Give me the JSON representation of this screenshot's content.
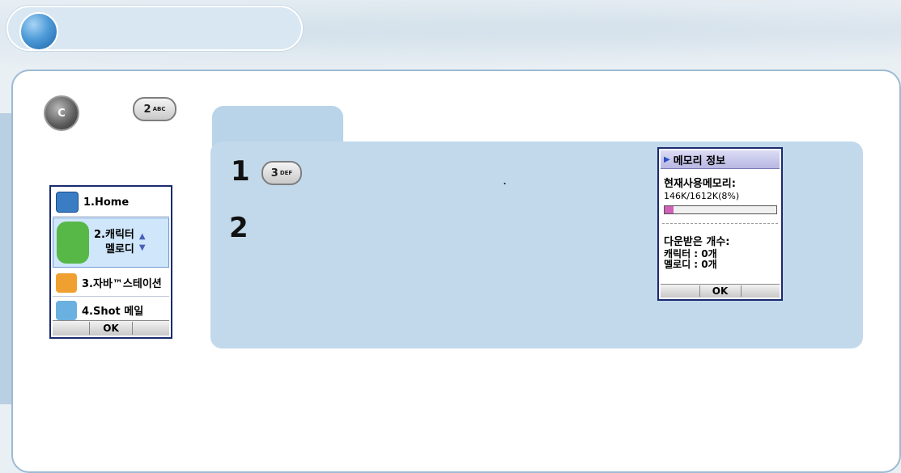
{
  "title_bar": {
    "title": ""
  },
  "keys": {
    "end_key": "C",
    "key_2": "2",
    "key_3": "3"
  },
  "phone_menu": {
    "items": [
      {
        "label": "1.Home"
      },
      {
        "label_line1": "2.캐릭터",
        "label_line2": "멜로디"
      },
      {
        "label": "3.자바™스테이션"
      },
      {
        "label": "4.Shot 메일"
      }
    ],
    "softkey": "OK"
  },
  "steps": {
    "step1": "1",
    "step2": "2",
    "dot": "."
  },
  "memory_screen": {
    "title": "메모리 정보",
    "used_label": "현재사용메모리:",
    "used_value": "146K/1612K(8%)",
    "used_fraction": 0.08,
    "download_label": "다운받은 개수:",
    "character_line": "캐릭터 : 0개",
    "melody_line": "멜로디 : 0개",
    "softkey": "OK"
  },
  "colors": {
    "accent": "#c2d9eb",
    "screen_border": "#1a2a6e",
    "memory_bar": "#d060b8"
  }
}
